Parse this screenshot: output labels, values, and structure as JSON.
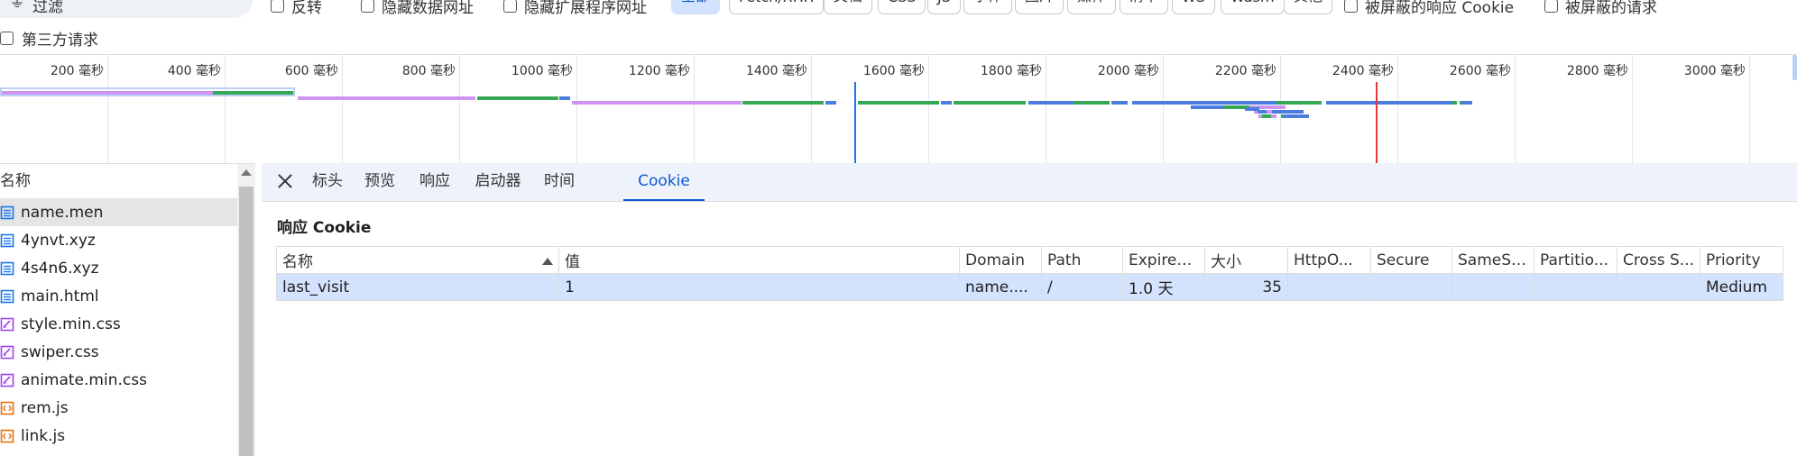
{
  "filter": {
    "icon": "filter-icon",
    "placeholder": "过滤",
    "checkboxes": [
      "反转",
      "隐藏数据网址",
      "隐藏扩展程序网址"
    ],
    "types": [
      "全部",
      "Fetch/XHR",
      "文档",
      "CSS",
      "JS",
      "字体",
      "图片",
      "媒体",
      "清单",
      "WS",
      "Wasm",
      "其他"
    ],
    "active_type": "全部",
    "extra_checkboxes": [
      "被屏蔽的响应 Cookie",
      "被屏蔽的请求"
    ],
    "third_party": "第三方请求"
  },
  "timeline": {
    "ticks": [
      "200 毫秒",
      "400 毫秒",
      "600 毫秒",
      "800 毫秒",
      "1000 毫秒",
      "1200 毫秒",
      "1400 毫秒",
      "1600 毫秒",
      "1800 毫秒",
      "2000 毫秒",
      "2200 毫秒",
      "2400 毫秒",
      "2600 毫秒",
      "2800 毫秒",
      "3000 毫秒"
    ],
    "colors": {
      "waiting": "#cf93f2",
      "download": "#34a853",
      "request": "#4b7de0",
      "dom_content_loaded": "#1a73e8",
      "load": "#e53935"
    }
  },
  "requests": {
    "header": "名称",
    "items": [
      {
        "name": "name.men",
        "type": "document"
      },
      {
        "name": "4ynvt.xyz",
        "type": "document"
      },
      {
        "name": "4s4n6.xyz",
        "type": "document"
      },
      {
        "name": "main.html",
        "type": "document"
      },
      {
        "name": "style.min.css",
        "type": "stylesheet"
      },
      {
        "name": "swiper.css",
        "type": "stylesheet"
      },
      {
        "name": "animate.min.css",
        "type": "stylesheet"
      },
      {
        "name": "rem.js",
        "type": "script"
      },
      {
        "name": "link.js",
        "type": "script"
      }
    ],
    "selected": "name.men"
  },
  "detail": {
    "tabs": [
      "标头",
      "预览",
      "响应",
      "启动器",
      "时间",
      "Cookie"
    ],
    "active_tab": "Cookie",
    "section_title": "响应 Cookie",
    "table": {
      "columns": [
        "名称",
        "值",
        "Domain",
        "Path",
        "Expires...",
        "大小",
        "HttpO...",
        "Secure",
        "SameSi...",
        "Partitio...",
        "Cross S...",
        "Priority"
      ],
      "rows": [
        [
          "last_visit",
          "1",
          "name....",
          "/",
          "1.0 天",
          "35",
          "",
          "",
          "",
          "",
          "",
          "Medium"
        ]
      ]
    }
  }
}
